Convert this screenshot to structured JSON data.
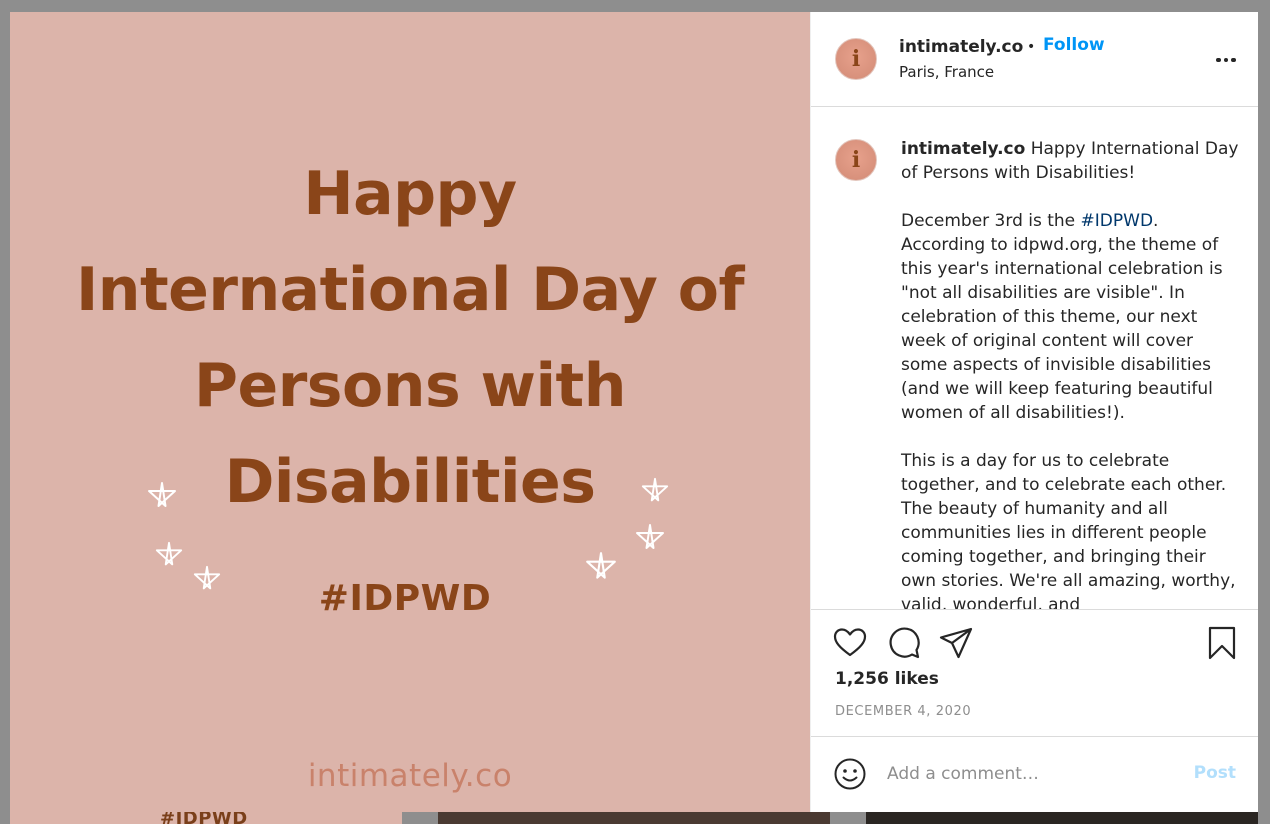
{
  "media": {
    "title_lines": [
      "Happy",
      "International Day of",
      "Persons with",
      "Disabilities"
    ],
    "hashtag": "#IDPWD",
    "brand": "intimately.co"
  },
  "background": {
    "tile_text": "#IDPWD"
  },
  "header": {
    "avatar_letter": "i",
    "username": "intimately.co",
    "dot": "•",
    "follow_label": "Follow",
    "location": "Paris, France"
  },
  "caption": {
    "username": "intimately.co",
    "text_1": "Happy International Day of Persons with Disabilities!",
    "para_2_pre": "December 3rd is the ",
    "para_2_tag": "#IDPWD",
    "para_2_post": ". According to idpwd.org, the theme of this year's international celebration is \"not all disabilities are visible\". In celebration of this theme, our next week of original content will cover some aspects of invisible disabilities (and we will keep featuring beautiful women of all disabilities!).",
    "para_3": "This is a day for us to celebrate together, and to celebrate each other. The beauty of humanity and all communities lies in different people coming together, and bringing their own stories. We're all amazing, worthy, valid, wonderful, and"
  },
  "actions": {
    "like_icon": "heart-icon",
    "comment_icon": "comment-icon",
    "share_icon": "paper-plane-icon",
    "save_icon": "bookmark-icon",
    "likes": "1,256 likes",
    "date": "DECEMBER 4, 2020"
  },
  "comment_box": {
    "emoji_icon": "smiley-icon",
    "placeholder": "Add a comment…",
    "post_label": "Post"
  },
  "colors": {
    "media_bg": "#dcb4aa",
    "title_brown": "#8a4519",
    "follow_blue": "#0095f6",
    "hashtag_link": "#00376b",
    "post_disabled": "#b2dffc"
  }
}
